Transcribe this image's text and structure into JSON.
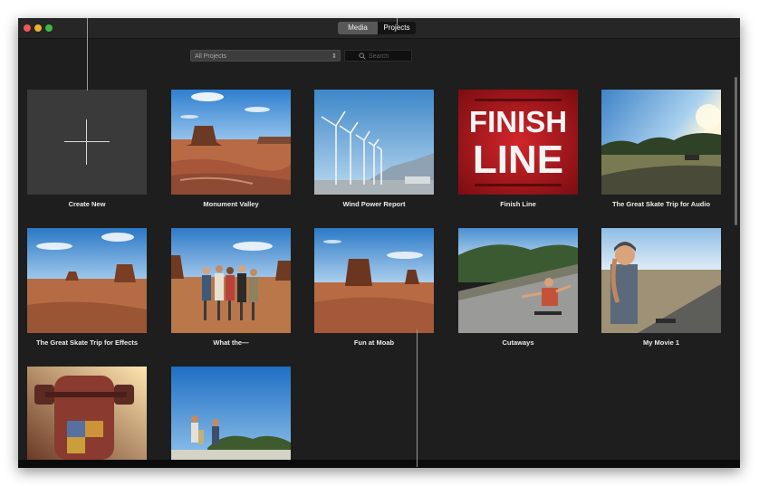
{
  "window": {
    "segment": {
      "media_label": "Media",
      "projects_label": "Projects",
      "selected": "Projects"
    }
  },
  "toolbar": {
    "filter_value": "All Projects",
    "search_placeholder": "Search"
  },
  "icons": {
    "filter_arrow": "up-down-chevron-icon",
    "search": "search-icon",
    "create_new": "plus-icon"
  },
  "projects": [
    {
      "label": "Create New"
    },
    {
      "label": "Monument Valley"
    },
    {
      "label": "Wind Power Report"
    },
    {
      "label": "Finish Line"
    },
    {
      "label": "The Great Skate Trip for Audio"
    },
    {
      "label": "The Great Skate Trip for Effects"
    },
    {
      "label": "What the—"
    },
    {
      "label": "Fun at Moab"
    },
    {
      "label": "Cutaways"
    },
    {
      "label": "My Movie 1"
    },
    {
      "label": ""
    },
    {
      "label": ""
    }
  ],
  "finish_line_text": [
    "FINISH",
    "LINE"
  ],
  "colors": {
    "window_bg": "#1e1e1e",
    "titlebar_bg": "#262626",
    "segment_selected": "#141414",
    "segment_unselected": "#585858",
    "finish_red": "#b11a1f"
  }
}
